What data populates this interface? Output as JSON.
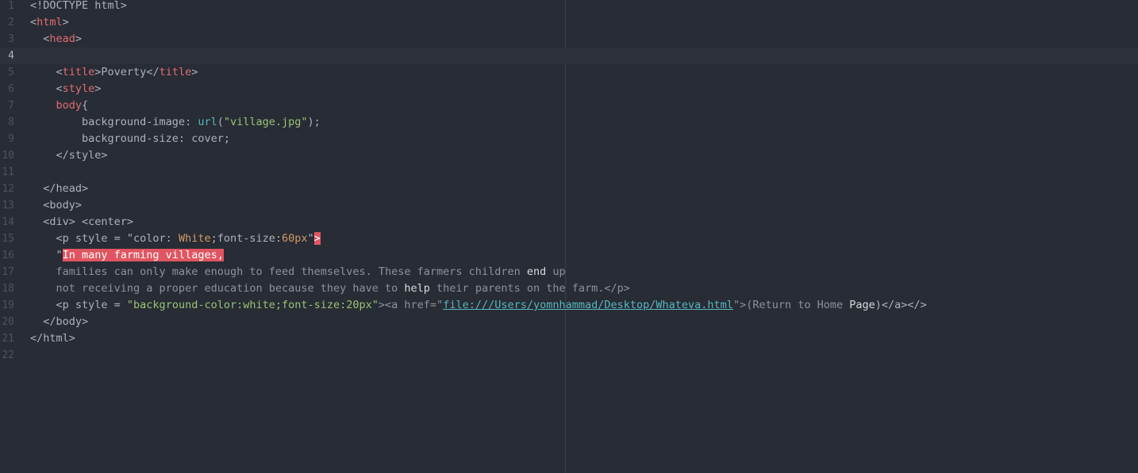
{
  "editor": {
    "cursor_line": 4,
    "lines": [
      {
        "num": "1",
        "tokens": [
          [
            "t-punct",
            "<!DOCTYPE html>"
          ]
        ]
      },
      {
        "num": "2",
        "tokens": [
          [
            "t-punct",
            "<"
          ],
          [
            "t-tag",
            "html"
          ],
          [
            "t-punct",
            ">"
          ]
        ]
      },
      {
        "num": "3",
        "tokens": [
          [
            "t-punct",
            "  <"
          ],
          [
            "t-tag",
            "head"
          ],
          [
            "t-punct",
            ">"
          ]
        ]
      },
      {
        "num": "4",
        "tokens": []
      },
      {
        "num": "5",
        "tokens": [
          [
            "t-punct",
            "    <"
          ],
          [
            "t-tag",
            "title"
          ],
          [
            "t-punct",
            ">"
          ],
          [
            "t-text",
            "Poverty"
          ],
          [
            "t-punct",
            "</"
          ],
          [
            "t-tag",
            "title"
          ],
          [
            "t-punct",
            ">"
          ]
        ]
      },
      {
        "num": "6",
        "tokens": [
          [
            "t-punct",
            "    <"
          ],
          [
            "t-tag",
            "style"
          ],
          [
            "t-punct",
            ">"
          ]
        ]
      },
      {
        "num": "7",
        "tokens": [
          [
            "t-plain",
            "    "
          ],
          [
            "t-tag",
            "body"
          ],
          [
            "t-punct",
            "{"
          ]
        ]
      },
      {
        "num": "8",
        "tokens": [
          [
            "t-plain",
            "        background-image: "
          ],
          [
            "t-func",
            "url"
          ],
          [
            "t-punct",
            "("
          ],
          [
            "t-str",
            "\"village.jpg\""
          ],
          [
            "t-punct",
            ");"
          ]
        ]
      },
      {
        "num": "9",
        "tokens": [
          [
            "t-plain",
            "        background-size: cover;"
          ]
        ]
      },
      {
        "num": "10",
        "tokens": [
          [
            "t-plain",
            "    </style>"
          ]
        ]
      },
      {
        "num": "11",
        "tokens": []
      },
      {
        "num": "12",
        "tokens": [
          [
            "t-plain",
            "  </head>"
          ]
        ]
      },
      {
        "num": "13",
        "tokens": [
          [
            "t-plain",
            "  <body>"
          ]
        ]
      },
      {
        "num": "14",
        "tokens": [
          [
            "t-plain",
            "  <div> <center>"
          ]
        ]
      },
      {
        "num": "15",
        "tokens": [
          [
            "t-plain",
            "    <p style = \"color: "
          ],
          [
            "t-attr",
            "White"
          ],
          [
            "t-plain",
            ";font-size:"
          ],
          [
            "t-num",
            "60px"
          ],
          [
            "t-plain",
            "\""
          ],
          [
            "t-err",
            ">"
          ]
        ]
      },
      {
        "num": "16",
        "tokens": [
          [
            "t-plain",
            "    \""
          ],
          [
            "t-err",
            "In many farming villages,"
          ]
        ]
      },
      {
        "num": "17",
        "tokens": [
          [
            "t-dim",
            "    families can only make enough to feed themselves. These farmers children "
          ],
          [
            "t-bright",
            "end"
          ],
          [
            "t-dim",
            " up"
          ]
        ]
      },
      {
        "num": "18",
        "tokens": [
          [
            "t-dim",
            "    not receiving a proper education because they have to "
          ],
          [
            "t-bright",
            "help"
          ],
          [
            "t-dim",
            " their parents on the farm.</p>"
          ]
        ]
      },
      {
        "num": "19",
        "tokens": [
          [
            "t-plain",
            "    <p style = "
          ],
          [
            "t-str",
            "\"background-color:white;font-size:20px\""
          ],
          [
            "t-dim",
            "><a href=\""
          ],
          [
            "t-link",
            "file:///Users/yomnhammad/Desktop/Whateva.html"
          ],
          [
            "t-dim",
            "\">(Return to Home "
          ],
          [
            "t-bright",
            "Page"
          ],
          [
            "t-plain",
            ")</a></>"
          ]
        ]
      },
      {
        "num": "20",
        "tokens": [
          [
            "t-plain",
            "  </body>"
          ]
        ]
      },
      {
        "num": "21",
        "tokens": [
          [
            "t-punct",
            "</"
          ],
          [
            "t-plain",
            "html"
          ],
          [
            "t-punct",
            ">"
          ]
        ]
      },
      {
        "num": "22",
        "tokens": []
      }
    ]
  }
}
